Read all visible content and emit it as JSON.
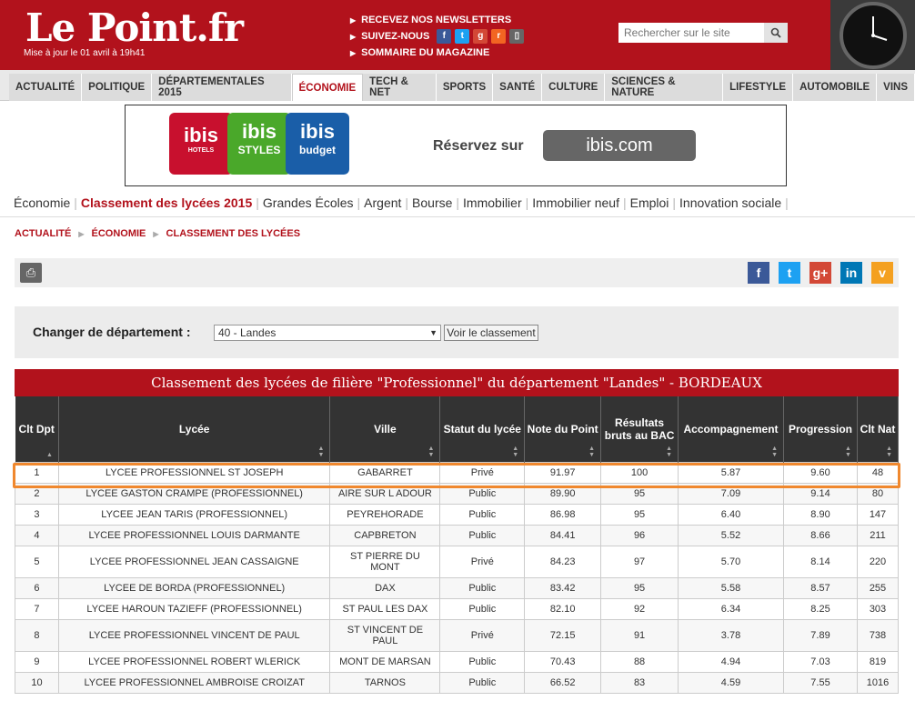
{
  "header": {
    "logo": "Le Point.fr",
    "update": "Mise à jour le 01 avril à 19h41",
    "links": [
      "RECEVEZ NOS NEWSLETTERS",
      "SUIVEZ-NOUS",
      "SOMMAIRE DU MAGAZINE"
    ],
    "search_placeholder": "Rechercher sur le site"
  },
  "nav": [
    "ACTUALITÉ",
    "POLITIQUE",
    "DÉPARTEMENTALES 2015",
    "ÉCONOMIE",
    "TECH & NET",
    "SPORTS",
    "SANTÉ",
    "CULTURE",
    "SCIENCES & NATURE",
    "LIFESTYLE",
    "AUTOMOBILE",
    "VINS"
  ],
  "ad": {
    "brands": [
      "ibis",
      "ibis",
      "ibis"
    ],
    "sub": [
      "HOTELS",
      "STYLES",
      "budget"
    ],
    "reserve": "Réservez sur",
    "site": "ibis.com"
  },
  "subnav": [
    "Économie",
    "Classement des lycées 2015",
    "Grandes Écoles",
    "Argent",
    "Bourse",
    "Immobilier",
    "Immobilier neuf",
    "Emploi",
    "Innovation sociale"
  ],
  "breadcrumb": [
    "ACTUALITÉ",
    "ÉCONOMIE",
    "CLASSEMENT DES LYCÉES"
  ],
  "dept": {
    "label": "Changer de département :",
    "selected": "40 - Landes",
    "button": "Voir le classement"
  },
  "table": {
    "title": "Classement des lycées de filière \"Professionnel\" du département \"Landes\" - BORDEAUX",
    "headers": [
      "Clt Dpt",
      "Lycée",
      "Ville",
      "Statut du lycée",
      "Note du Point",
      "Résultats bruts au BAC",
      "Accompagnement",
      "Progression",
      "Clt Nat"
    ],
    "rows": [
      [
        "1",
        "LYCEE PROFESSIONNEL ST JOSEPH",
        "GABARRET",
        "Privé",
        "91.97",
        "100",
        "5.87",
        "9.60",
        "48"
      ],
      [
        "2",
        "LYCEE GASTON CRAMPE (PROFESSIONNEL)",
        "AIRE SUR L ADOUR",
        "Public",
        "89.90",
        "95",
        "7.09",
        "9.14",
        "80"
      ],
      [
        "3",
        "LYCEE JEAN TARIS (PROFESSIONNEL)",
        "PEYREHORADE",
        "Public",
        "86.98",
        "95",
        "6.40",
        "8.90",
        "147"
      ],
      [
        "4",
        "LYCEE PROFESSIONNEL LOUIS DARMANTE",
        "CAPBRETON",
        "Public",
        "84.41",
        "96",
        "5.52",
        "8.66",
        "211"
      ],
      [
        "5",
        "LYCEE PROFESSIONNEL JEAN CASSAIGNE",
        "ST PIERRE DU MONT",
        "Privé",
        "84.23",
        "97",
        "5.70",
        "8.14",
        "220"
      ],
      [
        "6",
        "LYCEE DE BORDA (PROFESSIONNEL)",
        "DAX",
        "Public",
        "83.42",
        "95",
        "5.58",
        "8.57",
        "255"
      ],
      [
        "7",
        "LYCEE HAROUN TAZIEFF (PROFESSIONNEL)",
        "ST PAUL LES DAX",
        "Public",
        "82.10",
        "92",
        "6.34",
        "8.25",
        "303"
      ],
      [
        "8",
        "LYCEE PROFESSIONNEL VINCENT DE PAUL",
        "ST VINCENT DE PAUL",
        "Privé",
        "72.15",
        "91",
        "3.78",
        "7.89",
        "738"
      ],
      [
        "9",
        "LYCEE PROFESSIONNEL ROBERT WLERICK",
        "MONT DE MARSAN",
        "Public",
        "70.43",
        "88",
        "4.94",
        "7.03",
        "819"
      ],
      [
        "10",
        "LYCEE PROFESSIONNEL AMBROISE CROIZAT",
        "TARNOS",
        "Public",
        "66.52",
        "83",
        "4.59",
        "7.55",
        "1016"
      ]
    ]
  }
}
